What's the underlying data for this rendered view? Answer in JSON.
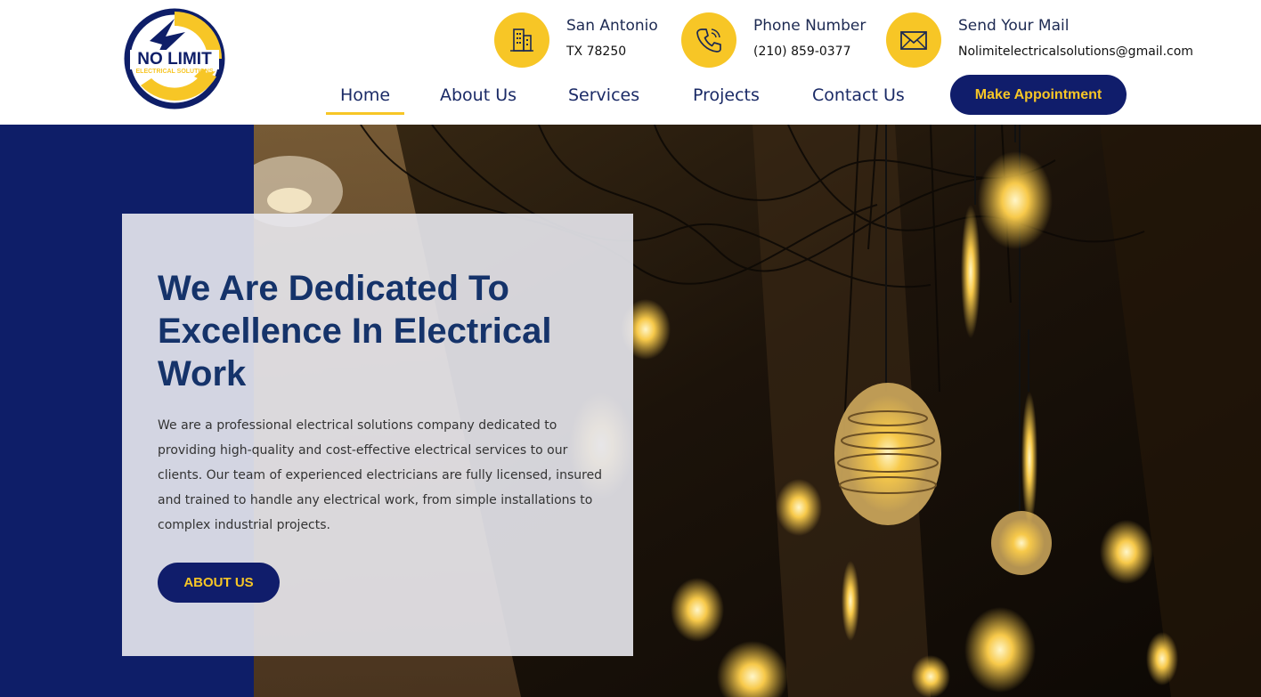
{
  "brand": {
    "logo_line1": "NO LIMIT",
    "logo_line2": "ELECTRICAL SOLUTIONS",
    "colors": {
      "navy": "#101d6b",
      "yellow": "#f7c626",
      "heading": "#15336a"
    }
  },
  "contact": {
    "location": {
      "title": "San Antonio",
      "value": "TX 78250",
      "icon": "building-icon"
    },
    "phone": {
      "title": "Phone Number",
      "value": "(210) 859-0377",
      "icon": "phone-icon"
    },
    "mail": {
      "title": "Send Your Mail",
      "value": "Nolimitelectricalsolutions@gmail.com",
      "icon": "envelope-icon"
    }
  },
  "nav": {
    "items": [
      {
        "label": "Home",
        "active": true
      },
      {
        "label": "About Us",
        "active": false
      },
      {
        "label": "Services",
        "active": false
      },
      {
        "label": "Projects",
        "active": false
      },
      {
        "label": "Contact Us",
        "active": false
      }
    ],
    "cta": "Make Appointment"
  },
  "hero": {
    "heading": "We Are Dedicated To Excellence In Electrical Work",
    "body": "We are a professional electrical solutions company dedicated to providing high-quality and cost-effective electrical services to our clients. Our team of experienced electricians are fully licensed, insured and trained to handle any electrical work, from simple installations to complex industrial projects.",
    "button": "ABOUT US"
  }
}
